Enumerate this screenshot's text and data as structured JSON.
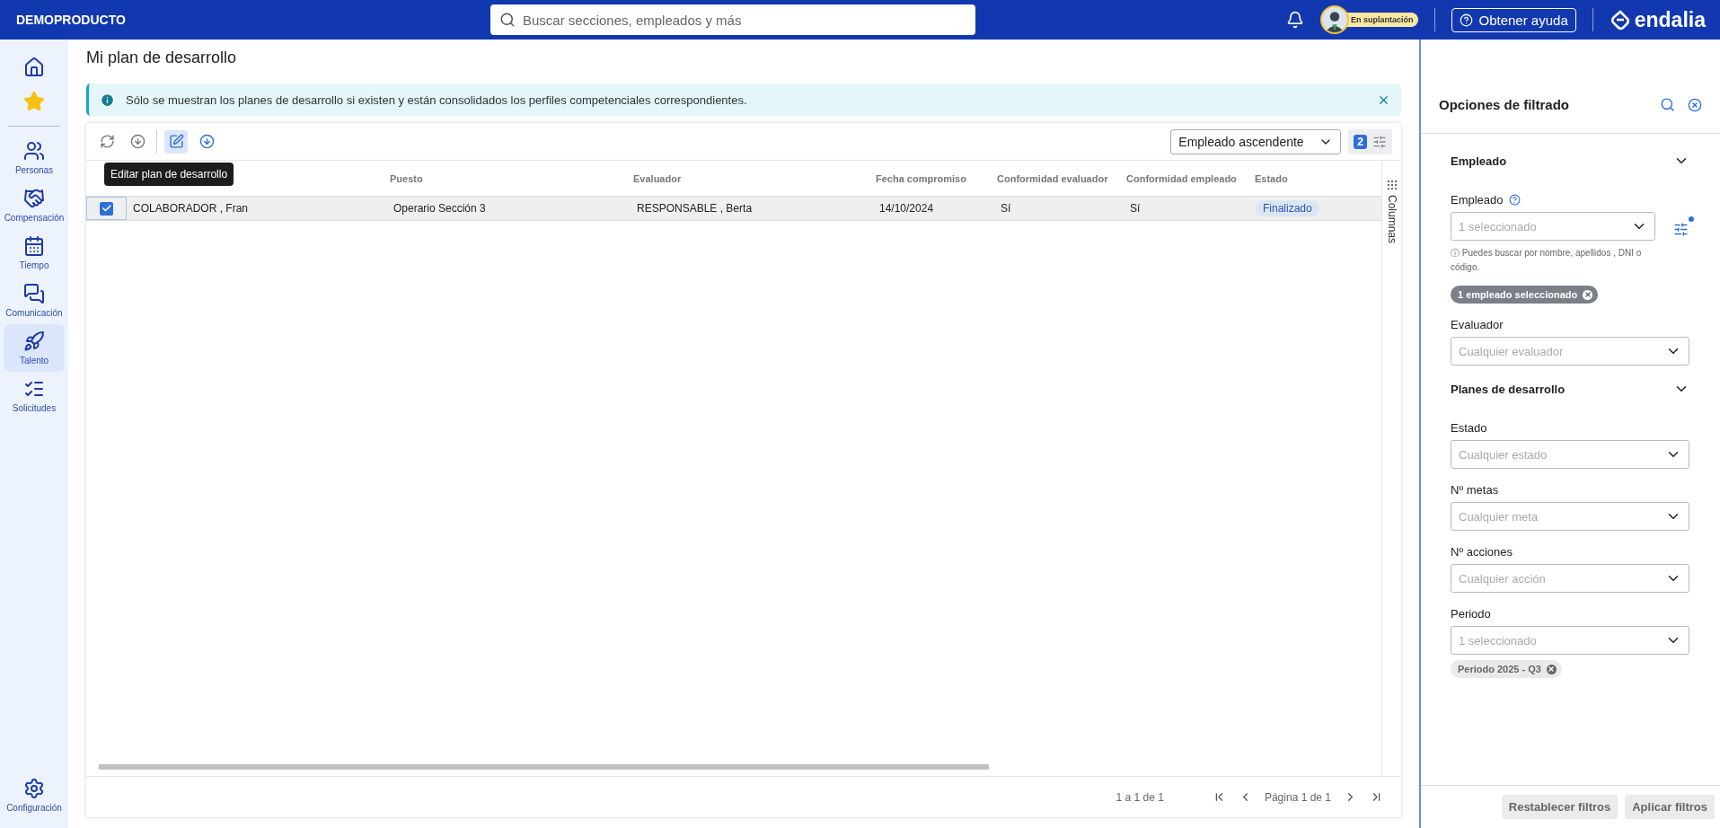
{
  "header": {
    "brand": "DEMOPRODUCTO",
    "search_placeholder": "Buscar secciones, empleados y más",
    "impersonation_badge": "En suplantación",
    "help_button": "Obtener ayuda",
    "logo": "endalia"
  },
  "sidebar": {
    "items": [
      {
        "kind": "home",
        "selected": false
      },
      {
        "kind": "favorites",
        "selected": false
      },
      {
        "kind": "people",
        "label": "Personas",
        "selected": false
      },
      {
        "kind": "handshake",
        "label": "Compensación",
        "selected": false
      },
      {
        "kind": "calendar",
        "label": "Tiempo",
        "selected": false
      },
      {
        "kind": "chat",
        "label": "Comunicación",
        "selected": false
      },
      {
        "kind": "rocket",
        "label": "Talento",
        "selected": true
      },
      {
        "kind": "checklist",
        "label": "Solicitudes",
        "selected": false
      }
    ],
    "bottom_item": {
      "kind": "settings",
      "label": "Configuración",
      "selected": false
    }
  },
  "page_title": "Mi plan de desarrollo",
  "banner": {
    "text": "Sólo se muestran los planes de desarrollo si existen y están consolidados los perfiles competenciales correspondientes."
  },
  "toolbar": {
    "buttons": [
      {
        "kind": "refresh",
        "selected": false
      },
      {
        "kind": "download",
        "selected": false
      },
      {
        "kind": "edit",
        "selected": true
      },
      {
        "kind": "download-blue",
        "selected": false
      }
    ],
    "tooltip": "Editar plan de desarrollo",
    "sort_value": "Empleado ascendente",
    "filter_count": "2"
  },
  "table": {
    "columns": [
      "",
      "Puesto",
      "Evaluador",
      "Fecha compromiso",
      "Conformidad evaluador",
      "Conformidad empleado",
      "Estado"
    ],
    "rows": [
      {
        "selected": true,
        "cells": [
          "COLABORADOR , Fran",
          "Operario Sección 3",
          "RESPONSABLE , Berta",
          "14/10/2024",
          "Sí",
          "Sí"
        ],
        "status": "Finalizado"
      }
    ],
    "columns_tab": "Columnas"
  },
  "pagination": {
    "range": "1 a 1 de 1",
    "page": "Página 1 de 1"
  },
  "filter_panel": {
    "title": "Opciones de filtrado",
    "sections": [
      {
        "title": "Empleado",
        "expanded": true,
        "fields": [
          {
            "label": "Empleado",
            "help": true,
            "placeholder": "1 seleccionado",
            "advanced": true,
            "hint": "ⓘ Puedes buscar por nombre, apellidos , DNI o código.",
            "chips": [
              {
                "label": "1 empleado seleccionado",
                "kind": "dark"
              }
            ]
          },
          {
            "label": "Evaluador",
            "help": false,
            "placeholder": "Cualquier evaluador",
            "advanced": false
          }
        ]
      },
      {
        "title": "Planes de desarrollo",
        "expanded": true,
        "fields": [
          {
            "label": "Estado",
            "help": false,
            "placeholder": "Cualquier estado",
            "advanced": false
          },
          {
            "label": "Nº metas",
            "help": false,
            "placeholder": "Cualquier meta",
            "advanced": false
          },
          {
            "label": "Nº acciones",
            "help": false,
            "placeholder": "Cualquier acción",
            "advanced": false
          },
          {
            "label": "Periodo",
            "help": false,
            "placeholder": "1 seleccionado",
            "advanced": false,
            "chips": [
              {
                "label": "Periodo 2025 - Q3",
                "kind": "light"
              }
            ]
          }
        ]
      }
    ],
    "buttons": [
      "Restablecer filtros",
      "Aplicar filtros"
    ]
  }
}
